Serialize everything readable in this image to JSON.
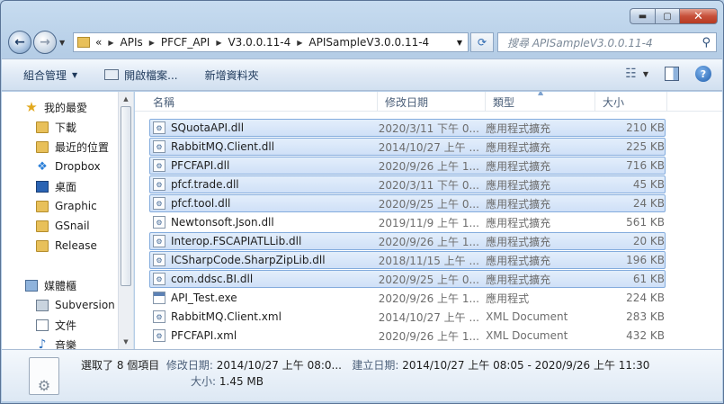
{
  "window": {
    "caption": {
      "minimize": "▬",
      "maximize": "▢",
      "close": "✕"
    }
  },
  "address": {
    "overflow": "«",
    "crumbs": [
      "APIs",
      "PFCF_API",
      "V3.0.0.11-4",
      "APISampleV3.0.0.11-4"
    ],
    "search_placeholder": "搜尋 APISampleV3.0.0.11-4"
  },
  "toolbar": {
    "organize": "組合管理",
    "open_file": "開啟檔案...",
    "new_folder": "新增資料夾"
  },
  "nav": {
    "favorites": "我的最愛",
    "items_fav": [
      "下載",
      "最近的位置",
      "Dropbox",
      "桌面",
      "Graphic",
      "GSnail",
      "Release"
    ],
    "libraries": "媒體櫃",
    "items_lib": [
      "Subversion",
      "文件",
      "音樂"
    ]
  },
  "columns": {
    "name": "名稱",
    "date": "修改日期",
    "type": "類型",
    "size": "大小"
  },
  "files": [
    {
      "name": "SQuotaAPI.dll",
      "date": "2020/3/11 下午 0...",
      "type": "應用程式擴充",
      "size": "210 KB",
      "selected": true,
      "icon": "dll"
    },
    {
      "name": "RabbitMQ.Client.dll",
      "date": "2014/10/27 上午 ...",
      "type": "應用程式擴充",
      "size": "225 KB",
      "selected": true,
      "icon": "dll"
    },
    {
      "name": "PFCFAPI.dll",
      "date": "2020/9/26 上午 1...",
      "type": "應用程式擴充",
      "size": "716 KB",
      "selected": true,
      "icon": "dll"
    },
    {
      "name": "pfcf.trade.dll",
      "date": "2020/3/11 下午 0...",
      "type": "應用程式擴充",
      "size": "45 KB",
      "selected": true,
      "icon": "dll"
    },
    {
      "name": "pfcf.tool.dll",
      "date": "2020/9/25 上午 0...",
      "type": "應用程式擴充",
      "size": "24 KB",
      "selected": true,
      "icon": "dll"
    },
    {
      "name": "Newtonsoft.Json.dll",
      "date": "2019/11/9 上午 1...",
      "type": "應用程式擴充",
      "size": "561 KB",
      "selected": false,
      "icon": "dll"
    },
    {
      "name": "Interop.FSCAPIATLLib.dll",
      "date": "2020/9/26 上午 1...",
      "type": "應用程式擴充",
      "size": "20 KB",
      "selected": true,
      "icon": "dll"
    },
    {
      "name": "ICSharpCode.SharpZipLib.dll",
      "date": "2018/11/15 上午 ...",
      "type": "應用程式擴充",
      "size": "196 KB",
      "selected": true,
      "icon": "dll"
    },
    {
      "name": "com.ddsc.BI.dll",
      "date": "2020/9/25 上午 0...",
      "type": "應用程式擴充",
      "size": "61 KB",
      "selected": true,
      "icon": "dll"
    },
    {
      "name": "API_Test.exe",
      "date": "2020/9/26 上午 1...",
      "type": "應用程式",
      "size": "224 KB",
      "selected": false,
      "icon": "exe"
    },
    {
      "name": "RabbitMQ.Client.xml",
      "date": "2014/10/27 上午 ...",
      "type": "XML Document",
      "size": "283 KB",
      "selected": false,
      "icon": "xml"
    },
    {
      "name": "PFCFAPI.xml",
      "date": "2020/9/26 上午 1...",
      "type": "XML Document",
      "size": "432 KB",
      "selected": false,
      "icon": "xml"
    }
  ],
  "details": {
    "selected_count": "選取了 8 個項目",
    "modified_label": "修改日期:",
    "modified_value": "2014/10/27 上午 08:0...",
    "created_label": "建立日期:",
    "created_value": "2014/10/27 上午 08:05 - 2020/9/26 上午 11:30",
    "size_label": "大小:",
    "size_value": "1.45 MB"
  }
}
